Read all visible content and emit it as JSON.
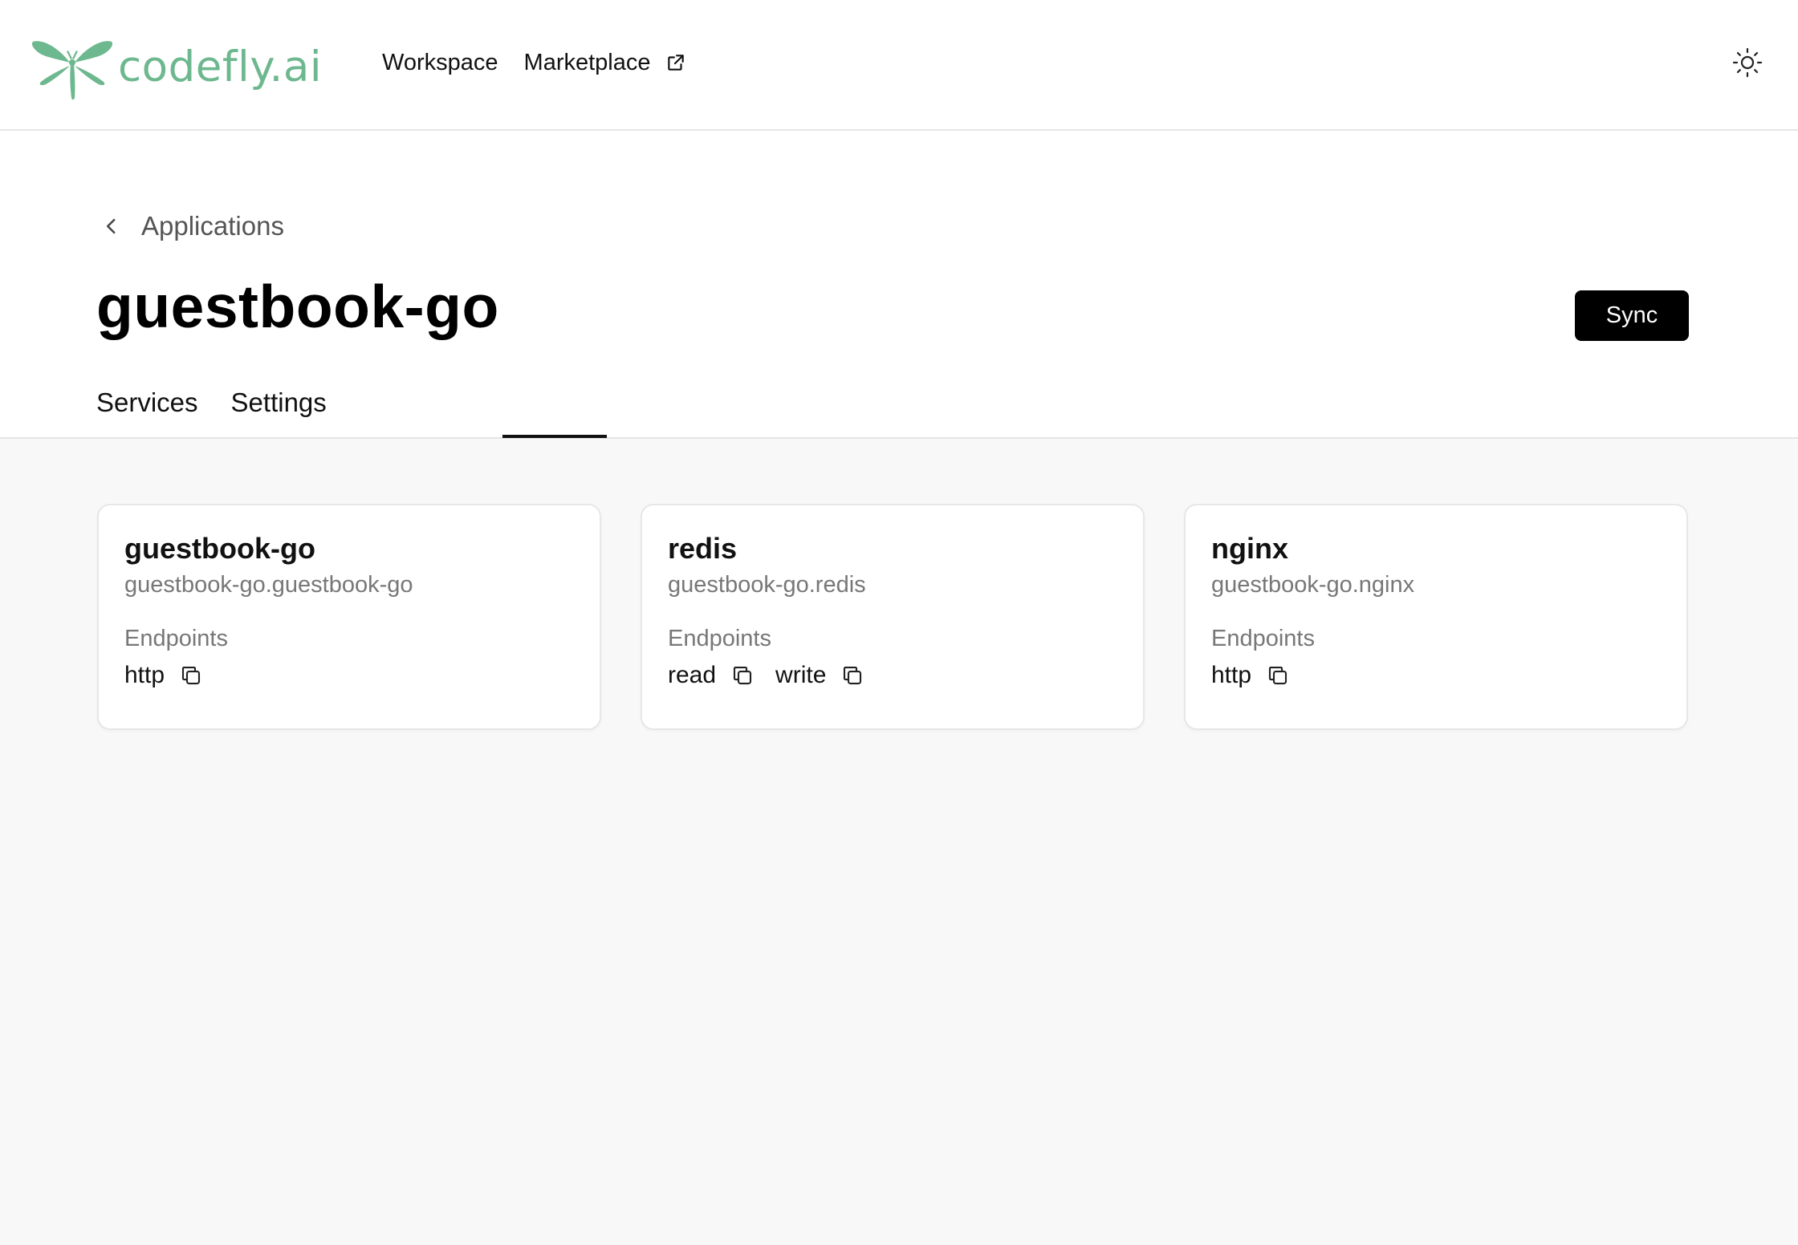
{
  "nav": {
    "logo_text": "codefly.ai",
    "links": [
      {
        "label": "Workspace"
      },
      {
        "label": "Marketplace",
        "icon": "external-link-icon"
      }
    ],
    "theme_icon": "sun-icon"
  },
  "header": {
    "breadcrumb": "Applications",
    "title": "guestbook-go",
    "sync_label": "Sync",
    "tabs": [
      {
        "label": "Services"
      },
      {
        "label": "Settings"
      }
    ]
  },
  "services": [
    {
      "name": "guestbook-go",
      "qualified_name": "guestbook-go.guestbook-go",
      "endpoints_label": "Endpoints",
      "endpoints": [
        "http"
      ]
    },
    {
      "name": "redis",
      "qualified_name": "guestbook-go.redis",
      "endpoints_label": "Endpoints",
      "endpoints": [
        "read",
        "write"
      ]
    },
    {
      "name": "nginx",
      "qualified_name": "guestbook-go.nginx",
      "endpoints_label": "Endpoints",
      "endpoints": [
        "http"
      ]
    }
  ],
  "colors": {
    "brand": "#6db88e",
    "primary_button": "#000000",
    "main_background": "#f8f8f8"
  }
}
